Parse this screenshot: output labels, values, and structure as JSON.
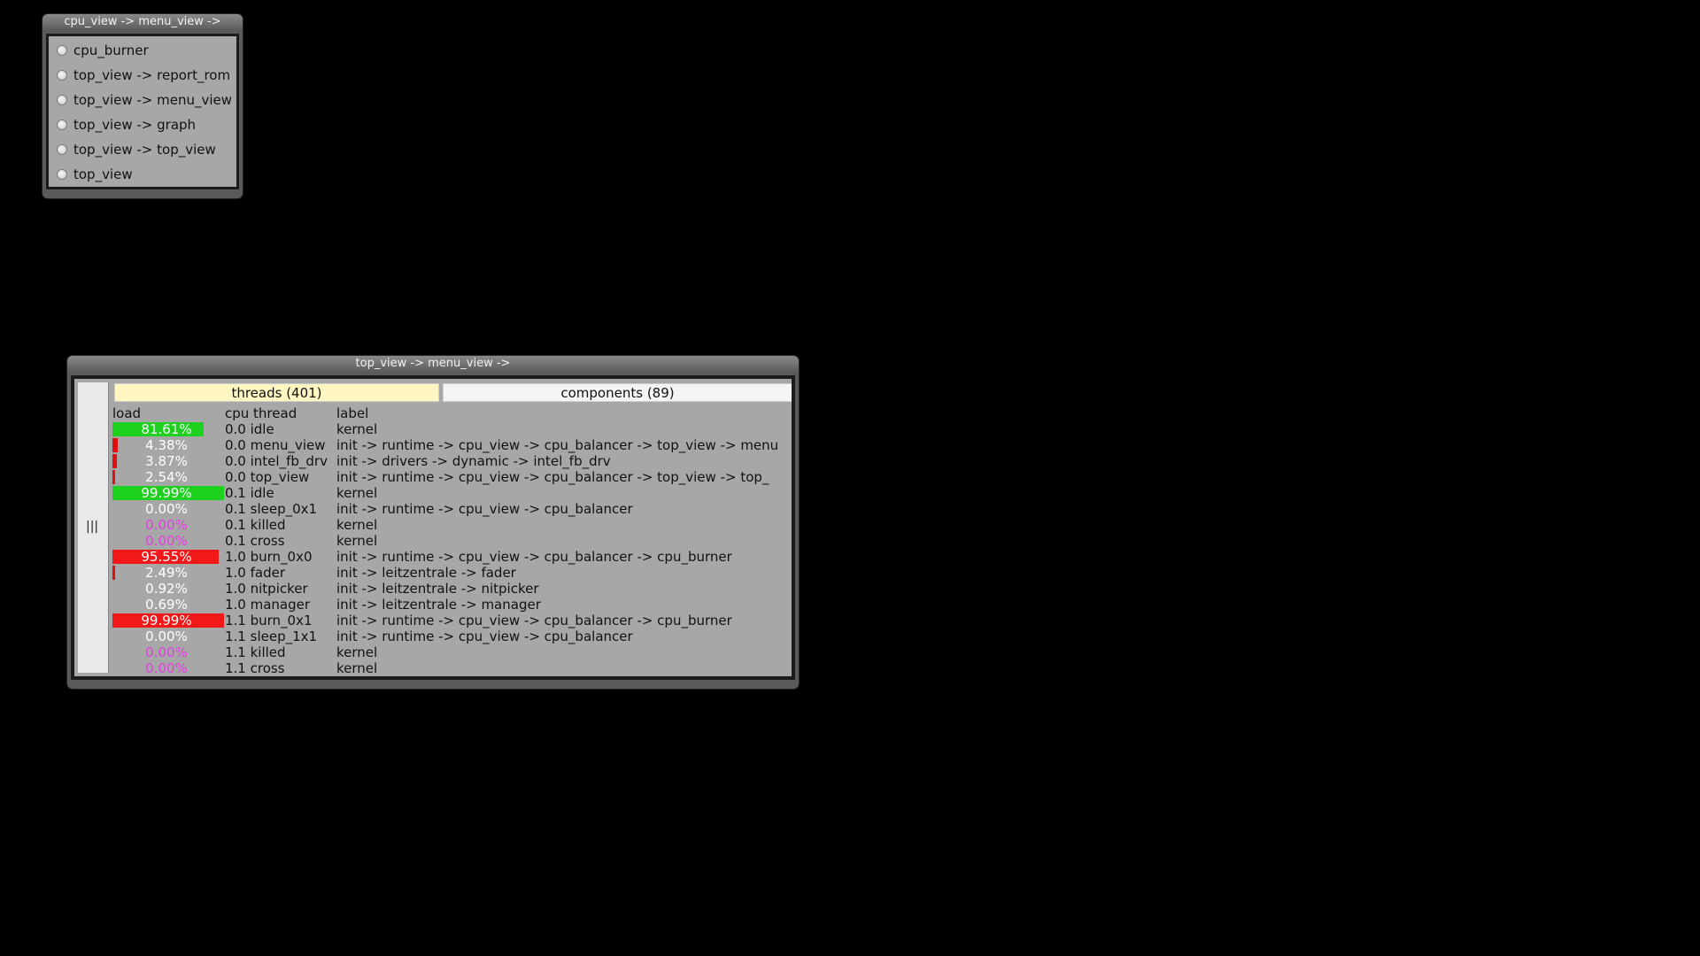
{
  "window1": {
    "title": "cpu_view -> menu_view ->",
    "items": [
      "cpu_burner",
      "top_view -> report_rom",
      "top_view -> menu_view",
      "top_view -> graph",
      "top_view -> top_view",
      "top_view"
    ]
  },
  "window2": {
    "title": "top_view -> menu_view ->",
    "tabs": {
      "threads": "threads (401)",
      "components": "components (89)"
    },
    "headers": {
      "load": "load",
      "cpu_thread": "cpu thread",
      "label": "label"
    },
    "rows": [
      {
        "load": "81.61%",
        "cpu_thread": "0.0 idle",
        "label": "kernel",
        "bar_color": "#1fd11f",
        "bar_fraction": 0.816,
        "text_color": "bar"
      },
      {
        "load": "4.38%",
        "cpu_thread": "0.0 menu_view",
        "label": "init -> runtime -> cpu_view -> cpu_balancer -> top_view -> menu",
        "bar_color": "#e01010",
        "bar_fraction": 0.044,
        "text_color": "white"
      },
      {
        "load": "3.87%",
        "cpu_thread": "0.0 intel_fb_drv",
        "label": "init -> drivers -> dynamic -> intel_fb_drv",
        "bar_color": "#e01010",
        "bar_fraction": 0.039,
        "text_color": "white"
      },
      {
        "load": "2.54%",
        "cpu_thread": "0.0 top_view",
        "label": "init -> runtime -> cpu_view -> cpu_balancer -> top_view -> top_",
        "bar_color": "#e01010",
        "bar_fraction": 0.025,
        "text_color": "white"
      },
      {
        "load": "99.99%",
        "cpu_thread": "0.1 idle",
        "label": "kernel",
        "bar_color": "#1fd11f",
        "bar_fraction": 1.0,
        "text_color": "bar"
      },
      {
        "load": "0.00%",
        "cpu_thread": "0.1 sleep_0x1",
        "label": "init -> runtime -> cpu_view -> cpu_balancer",
        "bar_color": "#e01010",
        "bar_fraction": 0,
        "text_color": "white"
      },
      {
        "load": "0.00%",
        "cpu_thread": "0.1 killed",
        "label": "kernel",
        "bar_color": "#e01010",
        "bar_fraction": 0,
        "text_color": "magenta"
      },
      {
        "load": "0.00%",
        "cpu_thread": "0.1 cross",
        "label": "kernel",
        "bar_color": "#e01010",
        "bar_fraction": 0,
        "text_color": "magenta"
      },
      {
        "load": "95.55%",
        "cpu_thread": "1.0 burn_0x0",
        "label": "init -> runtime -> cpu_view -> cpu_balancer -> cpu_burner",
        "bar_color": "#f01818",
        "bar_fraction": 0.956,
        "text_color": "bar"
      },
      {
        "load": "2.49%",
        "cpu_thread": "1.0 fader",
        "label": "init -> leitzentrale -> fader",
        "bar_color": "#e01010",
        "bar_fraction": 0.025,
        "text_color": "white"
      },
      {
        "load": "0.92%",
        "cpu_thread": "1.0 nitpicker",
        "label": "init -> leitzentrale -> nitpicker",
        "bar_color": "#e01010",
        "bar_fraction": 0,
        "text_color": "white"
      },
      {
        "load": "0.69%",
        "cpu_thread": "1.0 manager",
        "label": "init -> leitzentrale -> manager",
        "bar_color": "#e01010",
        "bar_fraction": 0,
        "text_color": "white"
      },
      {
        "load": "99.99%",
        "cpu_thread": "1.1 burn_0x1",
        "label": "init -> runtime -> cpu_view -> cpu_balancer -> cpu_burner",
        "bar_color": "#f01818",
        "bar_fraction": 1.0,
        "text_color": "bar"
      },
      {
        "load": "0.00%",
        "cpu_thread": "1.1 sleep_1x1",
        "label": "init -> runtime -> cpu_view -> cpu_balancer",
        "bar_color": "#e01010",
        "bar_fraction": 0,
        "text_color": "white"
      },
      {
        "load": "0.00%",
        "cpu_thread": "1.1 killed",
        "label": "kernel",
        "bar_color": "#e01010",
        "bar_fraction": 0,
        "text_color": "magenta"
      },
      {
        "load": "0.00%",
        "cpu_thread": "1.1 cross",
        "label": "kernel",
        "bar_color": "#e01010",
        "bar_fraction": 0,
        "text_color": "magenta"
      }
    ]
  }
}
